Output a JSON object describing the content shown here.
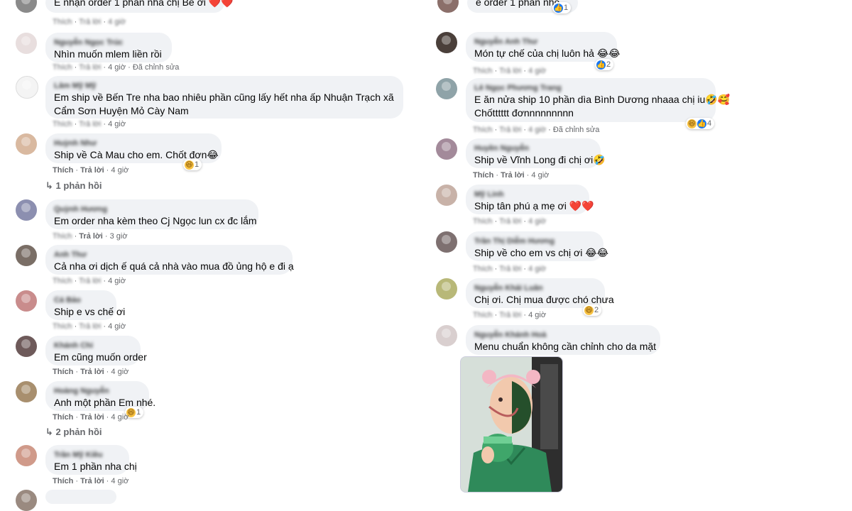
{
  "comments_left": [
    {
      "name": "",
      "text": "E nhận order 1 phần nha chị Bé ơi ❤️❤️",
      "like": "Thích",
      "reply": "Trả lời",
      "time": "4 giờ",
      "edited": "",
      "reaction": ""
    },
    {
      "name": "Nguyễn Ngọc Trúc",
      "text": "Nhìn muốn mlem liền rồi",
      "like": "Thích",
      "reply": "Trả lời",
      "time": "4 giờ",
      "edited": "Đã chỉnh sửa",
      "reaction": ""
    },
    {
      "name": "Lâm Mỹ Mỹ",
      "text": "Em ship về Bến Tre nha bao nhiêu phần cũng lấy hết nha ấp Nhuận Trạch xã Cẩm Sơn Huyện Mỏ Cày Nam",
      "like": "Thích",
      "reply": "Trả lời",
      "time": "4 giờ",
      "edited": "",
      "reaction": ""
    },
    {
      "name": "Huỳnh Như",
      "text": "Ship về Cà Mau cho em. Chốt đơn😂",
      "like": "Thích",
      "reply": "Trả lời",
      "time": "4 giờ",
      "edited": "",
      "reaction": "1",
      "replies": "1 phản hồi"
    },
    {
      "name": "Quỳnh Hương",
      "text": "Em order nha kèm theo Cj Ngọc lun cx đc lắm",
      "like": "Thích",
      "reply": "Trả lời",
      "time": "3 giờ",
      "edited": "",
      "reaction": ""
    },
    {
      "name": "Anh Thư",
      "text": "Cả nha ơi dịch ế quá cả nhà vào mua đồ ủng hộ e đi ạ",
      "like": "Thích",
      "reply": "Trả lời",
      "time": "4 giờ",
      "edited": "",
      "reaction": ""
    },
    {
      "name": "Cá Bảo",
      "text": "Ship e vs chế ơi",
      "like": "Thích",
      "reply": "Trả lời",
      "time": "4 giờ",
      "edited": "",
      "reaction": ""
    },
    {
      "name": "Khánh Chi",
      "text": "Em cũng muốn order",
      "like": "Thích",
      "reply": "Trả lời",
      "time": "4 giờ",
      "edited": "",
      "reaction": ""
    },
    {
      "name": "Hoàng Nguyễn",
      "text": "Anh một phần Em nhé.",
      "like": "Thích",
      "reply": "Trả lời",
      "time": "4 giờ",
      "edited": "",
      "reaction": "1",
      "replies": "2 phản hồi"
    },
    {
      "name": "Trần Mỹ Kiều",
      "text": "Em 1 phần nha chị",
      "like": "Thích",
      "reply": "Trả lời",
      "time": "4 giờ",
      "edited": "",
      "reaction": ""
    }
  ],
  "comments_right": [
    {
      "name": "",
      "text": "e order 1 phần nhé",
      "like": "",
      "reply": "",
      "time": "",
      "edited": "",
      "reaction": "1"
    },
    {
      "name": "Nguyễn Anh Thư",
      "text": "Món tự chế của chị luôn hả 😂😂",
      "like": "Thích",
      "reply": "Trả lời",
      "time": "4 giờ",
      "edited": "",
      "reaction": "2"
    },
    {
      "name": "Lê Ngọc Phương Trang",
      "text": "E ăn nửa ship 10 phần dìa Bình Dương nhaaa chị iu🤣🥰",
      "text2": "Chốtttttt đơnnnnnnnnn",
      "like": "Thích",
      "reply": "Trả lời",
      "time": "4 giờ",
      "edited": "Đã chỉnh sửa",
      "reaction": "4"
    },
    {
      "name": "Huyền Nguyễn",
      "text": "Ship về Vĩnh Long đi chị ơi🤣",
      "like": "Thích",
      "reply": "Trả lời",
      "time": "4 giờ",
      "edited": "",
      "reaction": ""
    },
    {
      "name": "Mỹ Linh",
      "text": "Ship tân phú ạ mẹ ơi ❤️❤️",
      "like": "Thích",
      "reply": "Trả lời",
      "time": "4 giờ",
      "edited": "",
      "reaction": ""
    },
    {
      "name": "Trần Thị Diễm Hương",
      "text": "Ship về cho em vs chị ơi 😂😂",
      "like": "Thích",
      "reply": "Trả lời",
      "time": "4 giờ",
      "edited": "",
      "reaction": ""
    },
    {
      "name": "Nguyễn Khải Luân",
      "text": "Chị ơi. Chị mua được chó chưa",
      "like": "Thích",
      "reply": "Trả lời",
      "time": "4 giờ",
      "edited": "",
      "reaction": "2"
    },
    {
      "name": "Nguyễn Khánh Hoà",
      "text": "Menu chuẩn không cần chỉnh cho da mặt",
      "like": "",
      "reply": "",
      "time": "",
      "edited": "",
      "reaction": ""
    }
  ],
  "icons": {
    "reply_arrow": "reply-arrow-icon",
    "haha": "haha-reaction-icon",
    "like": "like-reaction-icon"
  },
  "colors": {
    "bubble": "#f0f2f5",
    "meta": "#65676b",
    "like_blue": "#1877f2",
    "heart": "#e41e3f"
  }
}
